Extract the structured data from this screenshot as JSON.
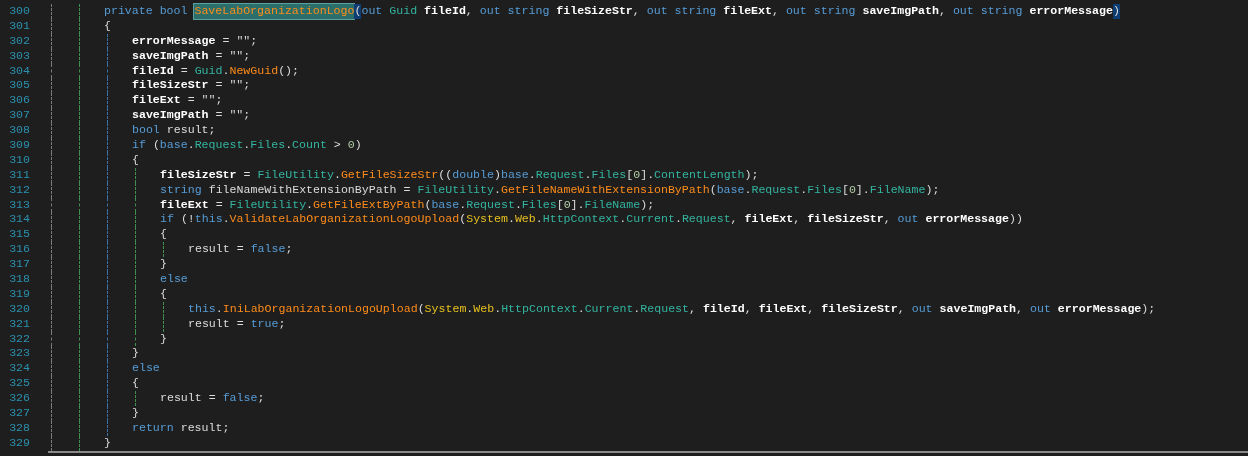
{
  "editor": {
    "lines": [
      {
        "number": "300",
        "tokens": [
          {
            "kind": "kw",
            "text": "private bool "
          },
          {
            "kind": "sel",
            "text": "SaveLabOrganizationLogo"
          },
          {
            "kind": "match",
            "text": "("
          },
          {
            "kind": "kw",
            "text": "out "
          },
          {
            "kind": "type",
            "text": "Guid "
          },
          {
            "kind": "var",
            "text": "fileId"
          },
          {
            "kind": "plain",
            "text": ", "
          },
          {
            "kind": "kw",
            "text": "out string "
          },
          {
            "kind": "var",
            "text": "fileSizeStr"
          },
          {
            "kind": "plain",
            "text": ", "
          },
          {
            "kind": "kw",
            "text": "out string "
          },
          {
            "kind": "var",
            "text": "fileExt"
          },
          {
            "kind": "plain",
            "text": ", "
          },
          {
            "kind": "kw",
            "text": "out string "
          },
          {
            "kind": "var",
            "text": "saveImgPath"
          },
          {
            "kind": "plain",
            "text": ", "
          },
          {
            "kind": "kw",
            "text": "out string "
          },
          {
            "kind": "var",
            "text": "errorMessage"
          },
          {
            "kind": "match",
            "text": ")"
          }
        ]
      },
      {
        "number": "301",
        "tokens": [
          {
            "kind": "plain",
            "text": "{"
          }
        ],
        "children": [
          {
            "number": "302",
            "tokens": [
              {
                "kind": "var",
                "text": "errorMessage"
              },
              {
                "kind": "plain",
                "text": " = "
              },
              {
                "kind": "str",
                "text": "\"\""
              },
              {
                "kind": "plain",
                "text": ";"
              }
            ]
          },
          {
            "number": "303",
            "tokens": [
              {
                "kind": "var",
                "text": "saveImgPath"
              },
              {
                "kind": "plain",
                "text": " = "
              },
              {
                "kind": "str",
                "text": "\"\""
              },
              {
                "kind": "plain",
                "text": ";"
              }
            ]
          },
          {
            "number": "304",
            "tokens": [
              {
                "kind": "var",
                "text": "fileId"
              },
              {
                "kind": "plain",
                "text": " = "
              },
              {
                "kind": "type",
                "text": "Guid"
              },
              {
                "kind": "plain",
                "text": "."
              },
              {
                "kind": "method",
                "text": "NewGuid"
              },
              {
                "kind": "plain",
                "text": "();"
              }
            ]
          },
          {
            "number": "305",
            "tokens": [
              {
                "kind": "var",
                "text": "fileSizeStr"
              },
              {
                "kind": "plain",
                "text": " = "
              },
              {
                "kind": "str",
                "text": "\"\""
              },
              {
                "kind": "plain",
                "text": ";"
              }
            ]
          },
          {
            "number": "306",
            "tokens": [
              {
                "kind": "var",
                "text": "fileExt"
              },
              {
                "kind": "plain",
                "text": " = "
              },
              {
                "kind": "str",
                "text": "\"\""
              },
              {
                "kind": "plain",
                "text": ";"
              }
            ]
          },
          {
            "number": "307",
            "tokens": [
              {
                "kind": "var",
                "text": "saveImgPath"
              },
              {
                "kind": "plain",
                "text": " = "
              },
              {
                "kind": "str",
                "text": "\"\""
              },
              {
                "kind": "plain",
                "text": ";"
              }
            ]
          },
          {
            "number": "308",
            "tokens": [
              {
                "kind": "kw",
                "text": "bool "
              },
              {
                "kind": "plain",
                "text": "result;"
              }
            ]
          },
          {
            "number": "309",
            "tokens": [
              {
                "kind": "kw",
                "text": "if "
              },
              {
                "kind": "plain",
                "text": "("
              },
              {
                "kind": "kw",
                "text": "base"
              },
              {
                "kind": "plain",
                "text": "."
              },
              {
                "kind": "type",
                "text": "Request"
              },
              {
                "kind": "plain",
                "text": "."
              },
              {
                "kind": "type",
                "text": "Files"
              },
              {
                "kind": "plain",
                "text": "."
              },
              {
                "kind": "type",
                "text": "Count"
              },
              {
                "kind": "plain",
                "text": " > "
              },
              {
                "kind": "num",
                "text": "0"
              },
              {
                "kind": "plain",
                "text": ")"
              }
            ]
          },
          {
            "number": "310",
            "tokens": [
              {
                "kind": "plain",
                "text": "{"
              }
            ],
            "children": [
              {
                "number": "311",
                "tokens": [
                  {
                    "kind": "var",
                    "text": "fileSizeStr"
                  },
                  {
                    "kind": "plain",
                    "text": " = "
                  },
                  {
                    "kind": "type",
                    "text": "FileUtility"
                  },
                  {
                    "kind": "plain",
                    "text": "."
                  },
                  {
                    "kind": "method",
                    "text": "GetFileSizeStr"
                  },
                  {
                    "kind": "plain",
                    "text": "(("
                  },
                  {
                    "kind": "kw",
                    "text": "double"
                  },
                  {
                    "kind": "plain",
                    "text": ")"
                  },
                  {
                    "kind": "kw",
                    "text": "base"
                  },
                  {
                    "kind": "plain",
                    "text": "."
                  },
                  {
                    "kind": "type",
                    "text": "Request"
                  },
                  {
                    "kind": "plain",
                    "text": "."
                  },
                  {
                    "kind": "type",
                    "text": "Files"
                  },
                  {
                    "kind": "plain",
                    "text": "["
                  },
                  {
                    "kind": "num",
                    "text": "0"
                  },
                  {
                    "kind": "plain",
                    "text": "]."
                  },
                  {
                    "kind": "type",
                    "text": "ContentLength"
                  },
                  {
                    "kind": "plain",
                    "text": ");"
                  }
                ]
              },
              {
                "number": "312",
                "tokens": [
                  {
                    "kind": "kw",
                    "text": "string "
                  },
                  {
                    "kind": "plain",
                    "text": "fileNameWithExtensionByPath = "
                  },
                  {
                    "kind": "type",
                    "text": "FileUtility"
                  },
                  {
                    "kind": "plain",
                    "text": "."
                  },
                  {
                    "kind": "method",
                    "text": "GetFileNameWithExtensionByPath"
                  },
                  {
                    "kind": "plain",
                    "text": "("
                  },
                  {
                    "kind": "kw",
                    "text": "base"
                  },
                  {
                    "kind": "plain",
                    "text": "."
                  },
                  {
                    "kind": "type",
                    "text": "Request"
                  },
                  {
                    "kind": "plain",
                    "text": "."
                  },
                  {
                    "kind": "type",
                    "text": "Files"
                  },
                  {
                    "kind": "plain",
                    "text": "["
                  },
                  {
                    "kind": "num",
                    "text": "0"
                  },
                  {
                    "kind": "plain",
                    "text": "]."
                  },
                  {
                    "kind": "type",
                    "text": "FileName"
                  },
                  {
                    "kind": "plain",
                    "text": ");"
                  }
                ]
              },
              {
                "number": "313",
                "tokens": [
                  {
                    "kind": "var",
                    "text": "fileExt"
                  },
                  {
                    "kind": "plain",
                    "text": " = "
                  },
                  {
                    "kind": "type",
                    "text": "FileUtility"
                  },
                  {
                    "kind": "plain",
                    "text": "."
                  },
                  {
                    "kind": "method",
                    "text": "GetFileExtByPath"
                  },
                  {
                    "kind": "plain",
                    "text": "("
                  },
                  {
                    "kind": "kw",
                    "text": "base"
                  },
                  {
                    "kind": "plain",
                    "text": "."
                  },
                  {
                    "kind": "type",
                    "text": "Request"
                  },
                  {
                    "kind": "plain",
                    "text": "."
                  },
                  {
                    "kind": "type",
                    "text": "Files"
                  },
                  {
                    "kind": "plain",
                    "text": "["
                  },
                  {
                    "kind": "num",
                    "text": "0"
                  },
                  {
                    "kind": "plain",
                    "text": "]."
                  },
                  {
                    "kind": "type",
                    "text": "FileName"
                  },
                  {
                    "kind": "plain",
                    "text": ");"
                  }
                ]
              },
              {
                "number": "314",
                "tokens": [
                  {
                    "kind": "kw",
                    "text": "if "
                  },
                  {
                    "kind": "plain",
                    "text": "(!"
                  },
                  {
                    "kind": "kw",
                    "text": "this"
                  },
                  {
                    "kind": "plain",
                    "text": "."
                  },
                  {
                    "kind": "method",
                    "text": "ValidateLabOrganizationLogoUpload"
                  },
                  {
                    "kind": "plain",
                    "text": "("
                  },
                  {
                    "kind": "ns",
                    "text": "System"
                  },
                  {
                    "kind": "plain",
                    "text": "."
                  },
                  {
                    "kind": "ns",
                    "text": "Web"
                  },
                  {
                    "kind": "plain",
                    "text": "."
                  },
                  {
                    "kind": "type",
                    "text": "HttpContext"
                  },
                  {
                    "kind": "plain",
                    "text": "."
                  },
                  {
                    "kind": "type",
                    "text": "Current"
                  },
                  {
                    "kind": "plain",
                    "text": "."
                  },
                  {
                    "kind": "type",
                    "text": "Request"
                  },
                  {
                    "kind": "plain",
                    "text": ", "
                  },
                  {
                    "kind": "var",
                    "text": "fileExt"
                  },
                  {
                    "kind": "plain",
                    "text": ", "
                  },
                  {
                    "kind": "var",
                    "text": "fileSizeStr"
                  },
                  {
                    "kind": "plain",
                    "text": ", "
                  },
                  {
                    "kind": "kw",
                    "text": "out "
                  },
                  {
                    "kind": "var",
                    "text": "errorMessage"
                  },
                  {
                    "kind": "plain",
                    "text": "))"
                  }
                ]
              },
              {
                "number": "315",
                "tokens": [
                  {
                    "kind": "plain",
                    "text": "{"
                  }
                ],
                "children": [
                  {
                    "number": "316",
                    "tokens": [
                      {
                        "kind": "plain",
                        "text": "result = "
                      },
                      {
                        "kind": "kw",
                        "text": "false"
                      },
                      {
                        "kind": "plain",
                        "text": ";"
                      }
                    ]
                  }
                ]
              },
              {
                "number": "317",
                "tokens": [
                  {
                    "kind": "plain",
                    "text": "}"
                  }
                ]
              },
              {
                "number": "318",
                "tokens": [
                  {
                    "kind": "kw",
                    "text": "else"
                  }
                ]
              },
              {
                "number": "319",
                "tokens": [
                  {
                    "kind": "plain",
                    "text": "{"
                  }
                ],
                "children": [
                  {
                    "number": "320",
                    "tokens": [
                      {
                        "kind": "kw",
                        "text": "this"
                      },
                      {
                        "kind": "plain",
                        "text": "."
                      },
                      {
                        "kind": "method",
                        "text": "IniLabOrganizationLogoUpload"
                      },
                      {
                        "kind": "plain",
                        "text": "("
                      },
                      {
                        "kind": "ns",
                        "text": "System"
                      },
                      {
                        "kind": "plain",
                        "text": "."
                      },
                      {
                        "kind": "ns",
                        "text": "Web"
                      },
                      {
                        "kind": "plain",
                        "text": "."
                      },
                      {
                        "kind": "type",
                        "text": "HttpContext"
                      },
                      {
                        "kind": "plain",
                        "text": "."
                      },
                      {
                        "kind": "type",
                        "text": "Current"
                      },
                      {
                        "kind": "plain",
                        "text": "."
                      },
                      {
                        "kind": "type",
                        "text": "Request"
                      },
                      {
                        "kind": "plain",
                        "text": ", "
                      },
                      {
                        "kind": "var",
                        "text": "fileId"
                      },
                      {
                        "kind": "plain",
                        "text": ", "
                      },
                      {
                        "kind": "var",
                        "text": "fileExt"
                      },
                      {
                        "kind": "plain",
                        "text": ", "
                      },
                      {
                        "kind": "var",
                        "text": "fileSizeStr"
                      },
                      {
                        "kind": "plain",
                        "text": ", "
                      },
                      {
                        "kind": "kw",
                        "text": "out "
                      },
                      {
                        "kind": "var",
                        "text": "saveImgPath"
                      },
                      {
                        "kind": "plain",
                        "text": ", "
                      },
                      {
                        "kind": "kw",
                        "text": "out "
                      },
                      {
                        "kind": "var",
                        "text": "errorMessage"
                      },
                      {
                        "kind": "plain",
                        "text": ");"
                      }
                    ]
                  },
                  {
                    "number": "321",
                    "tokens": [
                      {
                        "kind": "plain",
                        "text": "result = "
                      },
                      {
                        "kind": "kw",
                        "text": "true"
                      },
                      {
                        "kind": "plain",
                        "text": ";"
                      }
                    ]
                  }
                ]
              },
              {
                "number": "322",
                "tokens": [
                  {
                    "kind": "plain",
                    "text": "}"
                  }
                ]
              }
            ]
          },
          {
            "number": "323",
            "tokens": [
              {
                "kind": "plain",
                "text": "}"
              }
            ]
          },
          {
            "number": "324",
            "tokens": [
              {
                "kind": "kw",
                "text": "else"
              }
            ]
          },
          {
            "number": "325",
            "tokens": [
              {
                "kind": "plain",
                "text": "{"
              }
            ],
            "children": [
              {
                "number": "326",
                "tokens": [
                  {
                    "kind": "plain",
                    "text": "result = "
                  },
                  {
                    "kind": "kw",
                    "text": "false"
                  },
                  {
                    "kind": "plain",
                    "text": ";"
                  }
                ]
              }
            ]
          },
          {
            "number": "327",
            "tokens": [
              {
                "kind": "plain",
                "text": "}"
              }
            ]
          },
          {
            "number": "328",
            "tokens": [
              {
                "kind": "kw",
                "text": "return "
              },
              {
                "kind": "plain",
                "text": "result;"
              }
            ]
          }
        ]
      },
      {
        "number": "329",
        "tokens": [
          {
            "kind": "plain",
            "text": "}"
          }
        ]
      }
    ]
  }
}
